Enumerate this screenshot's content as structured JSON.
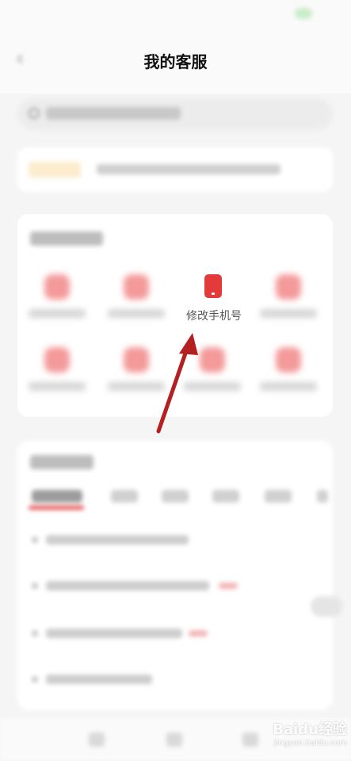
{
  "header": {
    "title": "我的客服",
    "back_icon": "chevron-left-icon"
  },
  "services": {
    "highlighted_item": {
      "label": "修改手机号",
      "icon": "mobile-phone-icon",
      "icon_color": "#e33b3b"
    }
  },
  "annotation": {
    "arrow_color": "#b3201f"
  },
  "watermark": {
    "brand": "Baidu经验",
    "url": "jingyan.baidu.com"
  }
}
